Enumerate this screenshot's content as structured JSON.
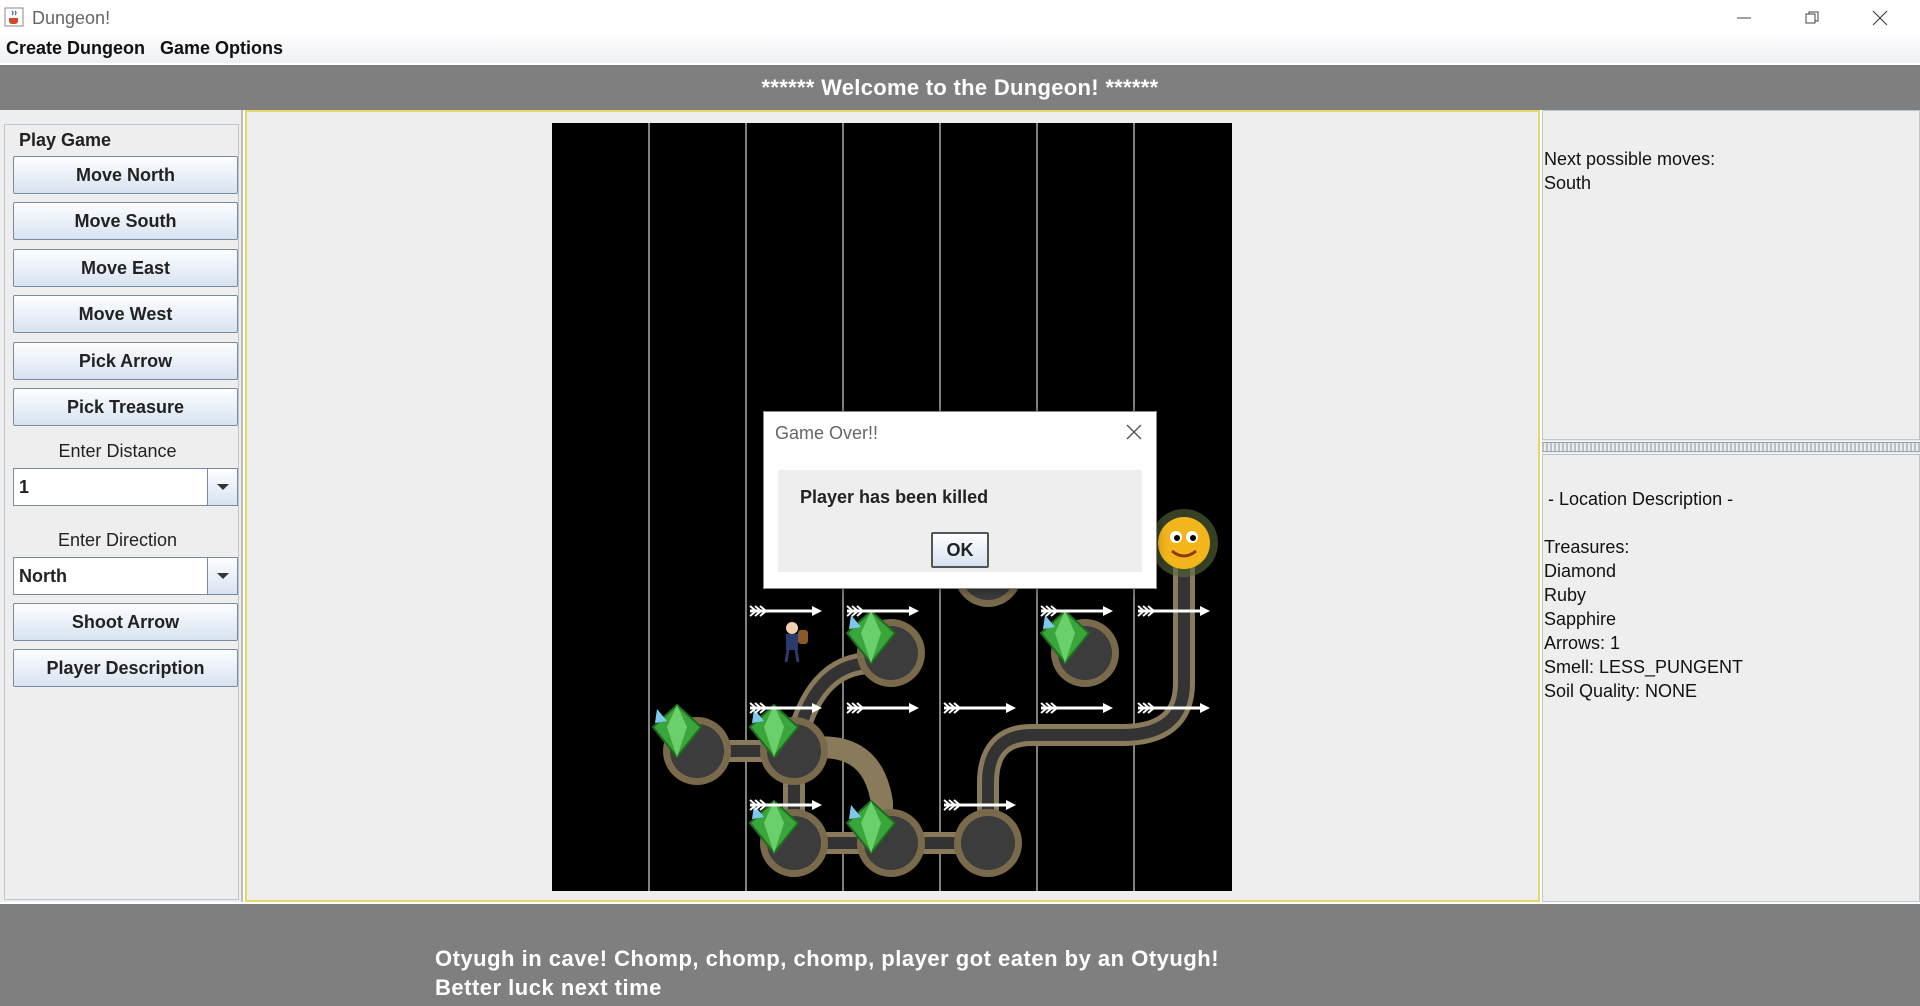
{
  "window": {
    "title": "Dungeon!"
  },
  "menu": {
    "items": [
      "Create Dungeon",
      "Game Options"
    ]
  },
  "header": {
    "text": "****** Welcome to the Dungeon! ******"
  },
  "left": {
    "group_label": "Play Game",
    "buttons": {
      "move_north": "Move North",
      "move_south": "Move South",
      "move_east": "Move East",
      "move_west": "Move West",
      "pick_arrow": "Pick Arrow",
      "pick_treasure": "Pick Treasure",
      "shoot_arrow": "Shoot Arrow",
      "player_description": "Player Description"
    },
    "distance_label": "Enter Distance",
    "distance_value": "1",
    "direction_label": "Enter Direction",
    "direction_value": "North"
  },
  "right": {
    "moves_title": "Next possible moves:",
    "moves": [
      "South"
    ],
    "location_title": "- Location Description -",
    "treasures_label": "Treasures:",
    "treasures": [
      "Diamond",
      "Ruby",
      "Sapphire"
    ],
    "arrows": "Arrows: 1",
    "smell": "Smell: LESS_PUNGENT",
    "soil": "Soil Quality: NONE"
  },
  "dialog": {
    "title": "Game Over!!",
    "message": "Player has been killed",
    "ok_label": "OK"
  },
  "footer": {
    "line1": "Otyugh in cave! Chomp, chomp, chomp, player got eaten by an Otyugh!",
    "line2": "Better luck next time"
  },
  "colors": {
    "band": "#7f7f7f",
    "panel": "#eeeeee",
    "board": "#000000",
    "gem": "#3aa53a",
    "tunnel": "#8a7a5c"
  }
}
